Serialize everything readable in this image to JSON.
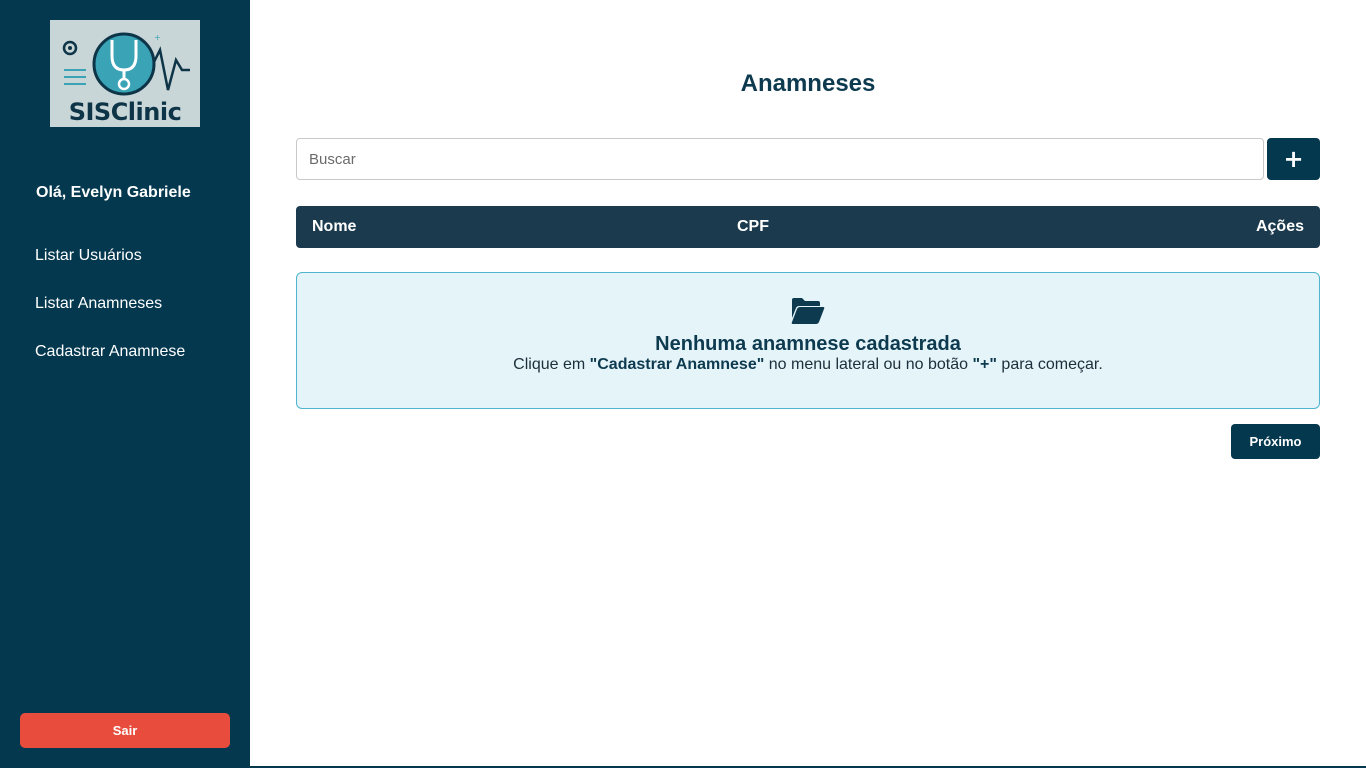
{
  "sidebar": {
    "logo_text": "SISClinic",
    "greeting": "Olá, Evelyn Gabriele",
    "items": [
      {
        "label": "Listar Usuários"
      },
      {
        "label": "Listar Anamneses"
      },
      {
        "label": "Cadastrar Anamnese"
      }
    ],
    "logout_label": "Sair"
  },
  "main": {
    "title": "Anamneses",
    "search": {
      "placeholder": "Buscar",
      "value": ""
    },
    "add_label": "+",
    "table": {
      "headers": [
        "Nome",
        "CPF",
        "Ações"
      ]
    },
    "empty": {
      "icon": "folder-open-icon",
      "title": "Nenhuma anamnese cadastrada",
      "text_before": "Clique em ",
      "text_strong_1": "\"Cadastrar Anamnese\"",
      "text_middle": " no menu lateral ou no botão ",
      "text_strong_2": "\"+\"",
      "text_after": " para começar."
    },
    "next_label": "Próximo"
  },
  "colors": {
    "sidebar_bg": "#04384f",
    "logout_bg": "#e74c3c",
    "table_header_bg": "#1b3a4d",
    "empty_bg": "#e4f4f9",
    "empty_border": "#4fb5ce"
  }
}
